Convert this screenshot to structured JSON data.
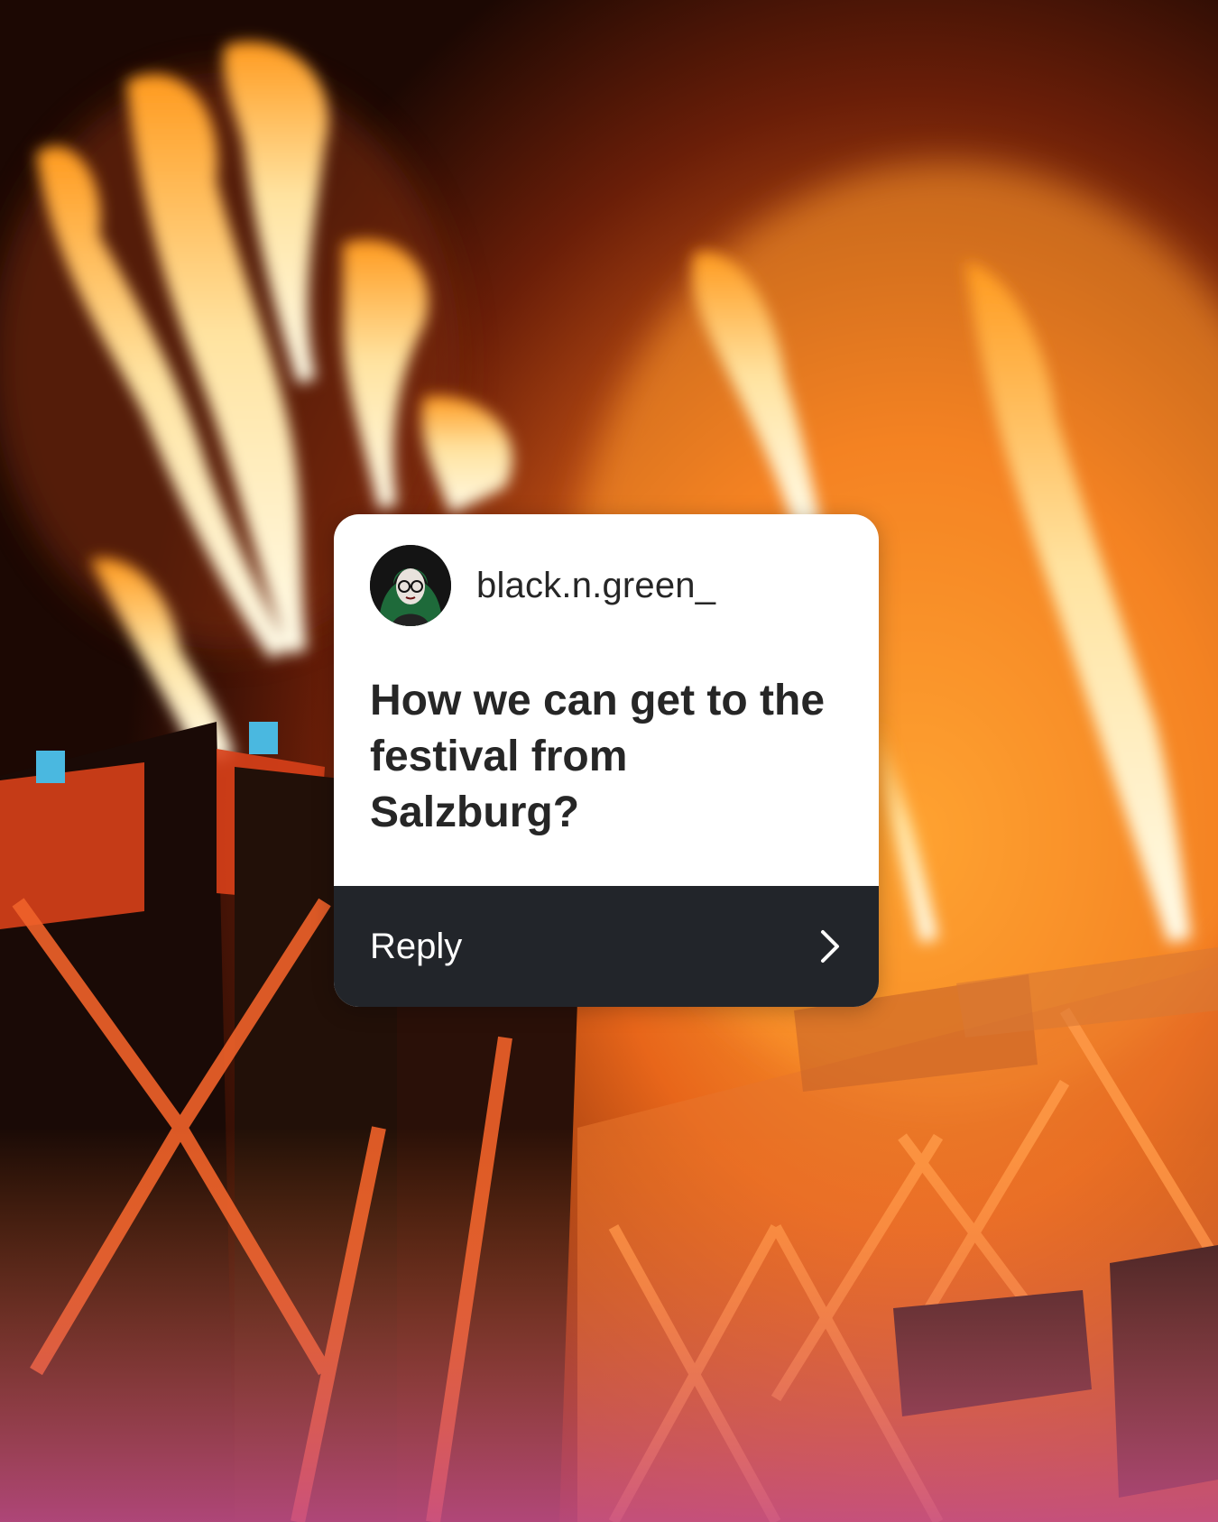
{
  "question_card": {
    "username": "black.n.green_",
    "avatar_icon": "user-avatar-icon",
    "question": "How we can get to the festival from Salzburg?",
    "reply_label": "Reply",
    "reply_icon": "chevron-right-icon"
  },
  "background": {
    "description_icon": "festival-stage-flames-photo",
    "colors": {
      "sky_dark": "#1a0703",
      "flame_orange": "#ff8a1a",
      "flame_core": "#fff6dc",
      "stage_dark": "#120805",
      "stage_accent": "#e0451b",
      "haze_pink": "#c05a8a"
    }
  },
  "card_colors": {
    "card_bg": "#ffffff",
    "reply_bar_bg": "#22252a",
    "text_primary": "#262626"
  }
}
